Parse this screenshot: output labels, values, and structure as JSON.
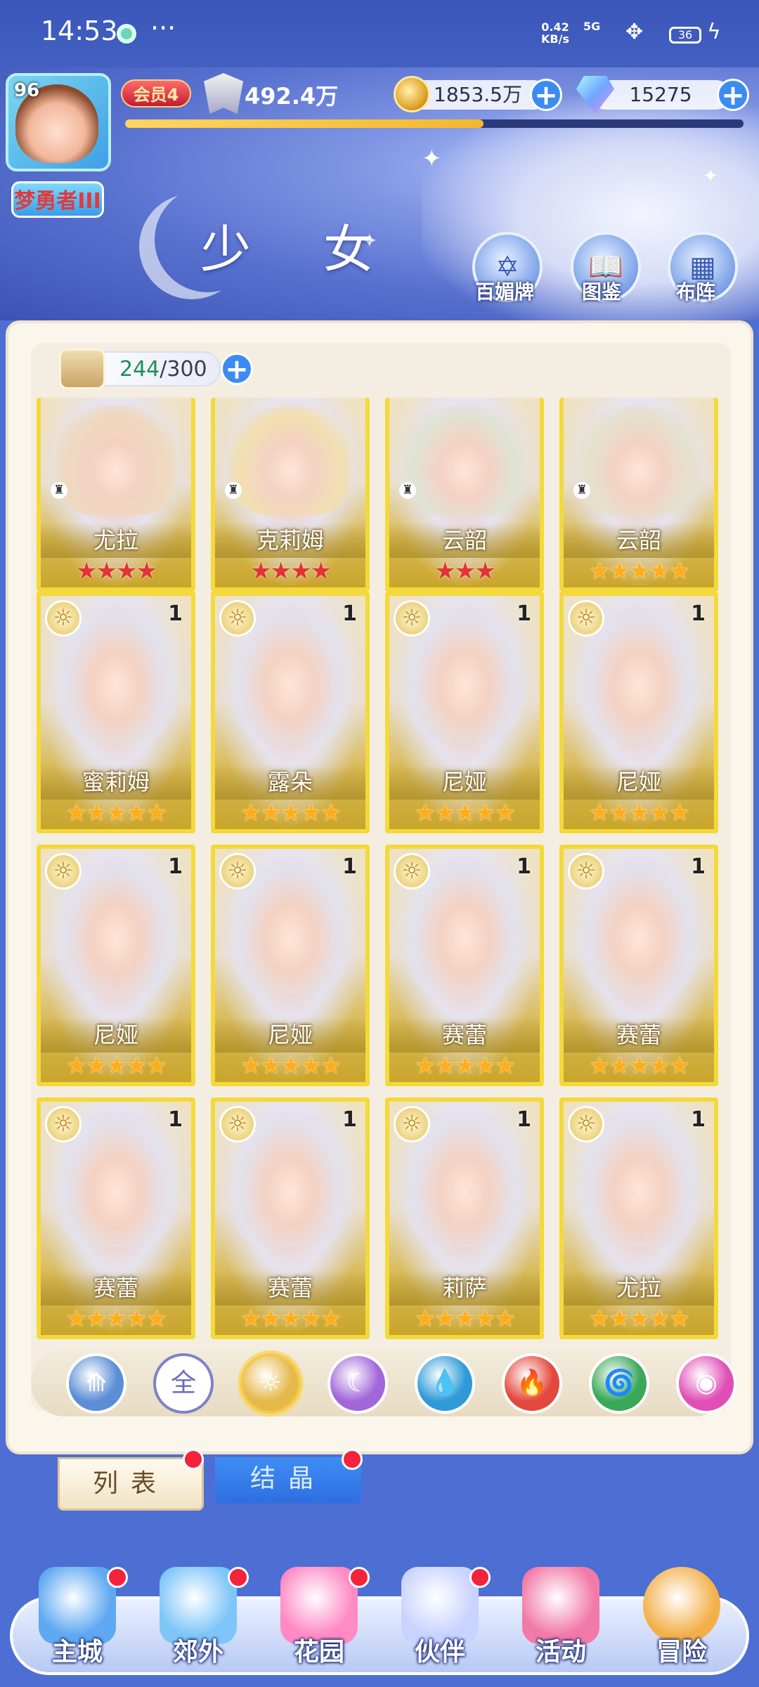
{
  "status_bar": {
    "time": "14:53",
    "network_speed": "0.42\nKB/s",
    "signal": "5G",
    "battery": "36"
  },
  "header": {
    "title": "少 女",
    "level": "96",
    "player_name": "梦勇者III",
    "vip": "会员4",
    "power": "492.4万",
    "power_progress": 0.58,
    "gold": "1853.5万",
    "gems": "15275",
    "buttons": [
      {
        "label": "百媚牌",
        "icon": "card-deck-icon"
      },
      {
        "label": "图鉴",
        "icon": "book-icon"
      },
      {
        "label": "布阵",
        "icon": "grid-icon"
      }
    ]
  },
  "inventory": {
    "current": "244",
    "max": "/300"
  },
  "cards": [
    {
      "name": "尤拉",
      "stars": 4,
      "star_color": "red",
      "count": "",
      "element": false
    },
    {
      "name": "克莉姆",
      "stars": 4,
      "star_color": "red",
      "count": "",
      "element": false
    },
    {
      "name": "云韶",
      "stars": 3,
      "star_color": "red",
      "count": "",
      "element": false
    },
    {
      "name": "云韶",
      "stars": 5,
      "star_color": "gold",
      "count": "",
      "element": false
    },
    {
      "name": "蜜莉姆",
      "stars": 5,
      "star_color": "gold",
      "count": "1",
      "element": true
    },
    {
      "name": "露朵",
      "stars": 5,
      "star_color": "gold",
      "count": "1",
      "element": true
    },
    {
      "name": "尼娅",
      "stars": 5,
      "star_color": "gold",
      "count": "1",
      "element": true
    },
    {
      "name": "尼娅",
      "stars": 5,
      "star_color": "gold",
      "count": "1",
      "element": true
    },
    {
      "name": "尼娅",
      "stars": 5,
      "star_color": "gold",
      "count": "1",
      "element": true
    },
    {
      "name": "尼娅",
      "stars": 5,
      "star_color": "gold",
      "count": "1",
      "element": true
    },
    {
      "name": "赛蕾",
      "stars": 5,
      "star_color": "gold",
      "count": "1",
      "element": true
    },
    {
      "name": "赛蕾",
      "stars": 5,
      "star_color": "gold",
      "count": "1",
      "element": true
    },
    {
      "name": "赛蕾",
      "stars": 5,
      "star_color": "gold",
      "count": "1",
      "element": true
    },
    {
      "name": "赛蕾",
      "stars": 5,
      "star_color": "gold",
      "count": "1",
      "element": true
    },
    {
      "name": "莉萨",
      "stars": 5,
      "star_color": "gold",
      "count": "1",
      "element": true
    },
    {
      "name": "尤拉",
      "stars": 5,
      "star_color": "gold",
      "count": "1",
      "element": true
    }
  ],
  "filters": [
    {
      "id": "wind",
      "label": "",
      "color": "#5b8ed6"
    },
    {
      "id": "all",
      "label": "全",
      "color": "#7f80c8"
    },
    {
      "id": "light",
      "label": "",
      "color": "#e6b84a"
    },
    {
      "id": "moon",
      "label": "",
      "color": "#a166d8"
    },
    {
      "id": "water",
      "label": "",
      "color": "#2e9ad8"
    },
    {
      "id": "fire",
      "label": "",
      "color": "#e4473c"
    },
    {
      "id": "nature",
      "label": "",
      "color": "#3aa858"
    },
    {
      "id": "dark",
      "label": "",
      "color": "#e04fb5"
    }
  ],
  "tabs": {
    "list": "列表",
    "crystal": "结晶"
  },
  "nav": [
    {
      "label": "主城",
      "icon": "castle-icon",
      "badge": true
    },
    {
      "label": "郊外",
      "icon": "portal-icon",
      "badge": true
    },
    {
      "label": "花园",
      "icon": "heart-icon",
      "badge": true
    },
    {
      "label": "伙伴",
      "icon": "partner-icon",
      "badge": true
    },
    {
      "label": "活动",
      "icon": "gift-icon",
      "badge": false
    },
    {
      "label": "冒险",
      "icon": "compass-icon",
      "badge": false
    }
  ]
}
